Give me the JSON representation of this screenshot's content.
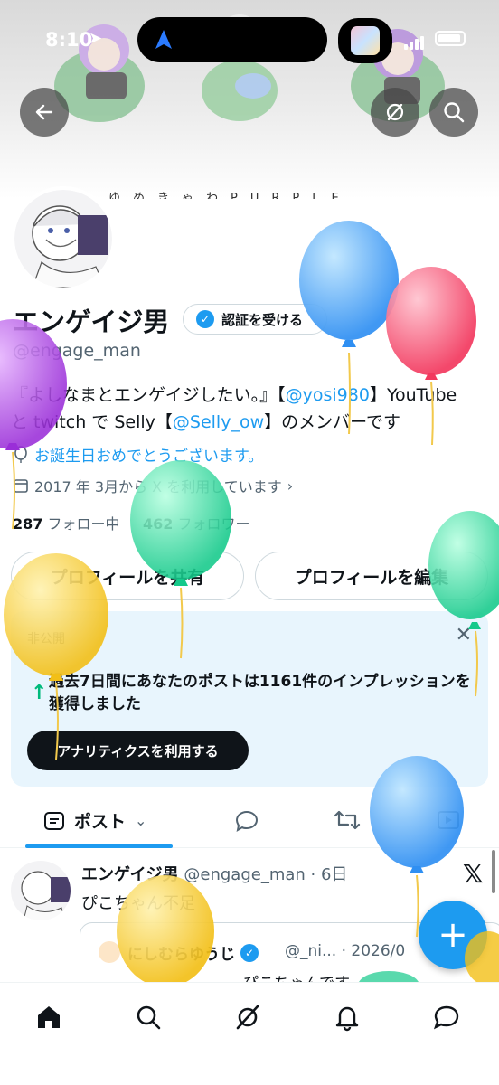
{
  "status_bar": {
    "time": "8:10"
  },
  "banner": {
    "caption": "ゆめきゃわPURPLE"
  },
  "profile": {
    "name": "エンゲイジ男",
    "verify_label": "認証を受ける",
    "handle": "@engage_man",
    "bio_line1_prefix": "『よしなまとエンゲイジしたい。』【",
    "bio_mention1": "@yosi980",
    "bio_line1_suffix": "】YouTube",
    "bio_line2_prefix": "と twitch で Selly【",
    "bio_mention2": "@Selly_ow",
    "bio_line2_suffix": "】のメンバーです",
    "birthday": "お誕生日おめでとうございます。",
    "joined": "2017 年 3月から X を利用しています",
    "following_count": "287",
    "following_label": "フォロー中",
    "followers_count": "462",
    "followers_label": "フォロワー",
    "share_button": "プロフィールを共有",
    "edit_button": "プロフィールを編集"
  },
  "analytics_card": {
    "private_label": "非公開",
    "text": "過去7日間にあなたのポストは1161件のインプレッションを獲得しました",
    "button": "アナリティクスを利用する"
  },
  "tabs": {
    "posts_label": "ポスト"
  },
  "post": {
    "author": "エンゲイジ男",
    "meta": "@engage_man · 6日",
    "text": "ぴこちゃん不足",
    "quote_author": "にしむらゆうじ",
    "quote_meta": "@_ni... · 2026/0",
    "quote_text": "ぴこちゃんです"
  },
  "fab": {
    "label": "+"
  },
  "colors": {
    "accent": "#1d9bf0",
    "text": "#0f1419",
    "muted": "#536471"
  },
  "icons": [
    "back-arrow-icon",
    "hide-icon",
    "search-icon",
    "verified-icon",
    "balloon-icon",
    "calendar-icon",
    "close-icon",
    "trending-up-icon",
    "posts-icon",
    "reply-icon",
    "repost-icon",
    "media-icon",
    "x-logo-icon",
    "home-icon",
    "grok-icon",
    "bell-icon",
    "messages-icon"
  ]
}
